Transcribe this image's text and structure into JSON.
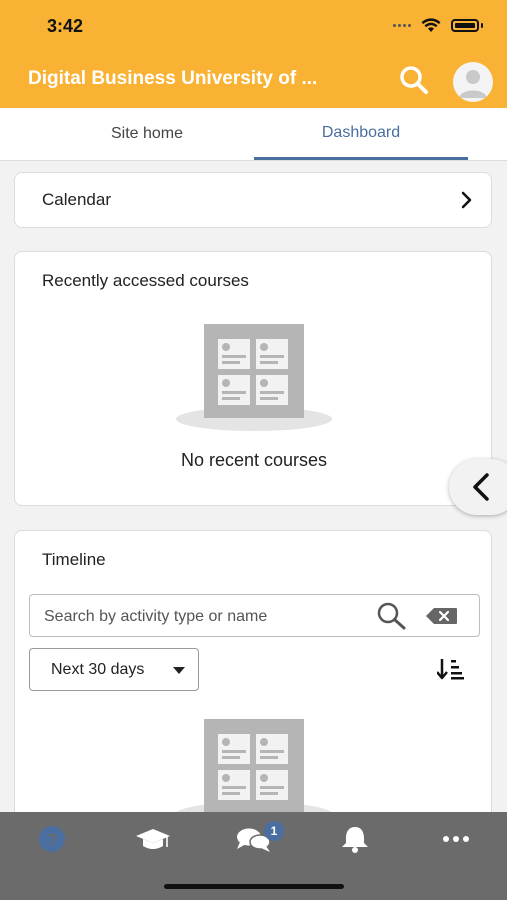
{
  "status_bar": {
    "time": "3:42"
  },
  "header": {
    "title": "Digital Business University of ...",
    "search_icon": "search-icon",
    "avatar_icon": "user-avatar-icon"
  },
  "tabs": [
    {
      "label": "Site home",
      "active": false
    },
    {
      "label": "Dashboard",
      "active": true
    }
  ],
  "calendar": {
    "label": "Calendar"
  },
  "recent_courses": {
    "title": "Recently accessed courses",
    "empty_text": "No recent courses"
  },
  "timeline": {
    "title": "Timeline",
    "search_placeholder": "Search by activity type or name",
    "filter_value": "Next 30 days"
  },
  "bottom_nav": {
    "items": [
      "help-icon",
      "courses-icon",
      "messages-icon",
      "notifications-icon",
      "more-icon"
    ],
    "messages_badge": "1"
  },
  "colors": {
    "brand": "#f9b233",
    "accent": "#4a6ea0",
    "bottom_bar": "#6b6b6b"
  }
}
